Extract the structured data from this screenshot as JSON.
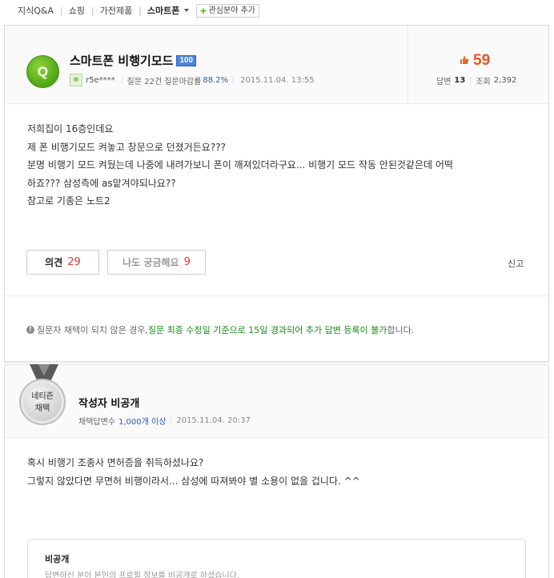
{
  "breadcrumb": {
    "items": [
      "지식Q&A",
      "쇼핑",
      "가전제품"
    ],
    "current": "스마트폰",
    "add_interest": "관심분야 추가"
  },
  "question": {
    "badge": "Q",
    "title": "스마트폰 비행기모드",
    "points": "100",
    "author": "r5e****",
    "stats_prefix": "질문 22건 질문마감률",
    "close_rate": "88.2%",
    "date": "2015.11.04. 13:55",
    "recommend_count": "59",
    "answers_label": "답변",
    "answers_count": "13",
    "views_label": "조회",
    "views_count": "2,392",
    "body": [
      "저희집이 16층인데요",
      "제 폰 비행기모드 켜놓고 창문으로 던졌거든요???",
      "분명 비행기 모드 켜뒀는데 나중에 내려가보니 폰이 깨져있더라구요... 비행기 모드 작동 안된것같은데 어떡",
      "하죠??? 삼성측에 as맡겨야되나요??",
      "참고로 기종은 노트2"
    ],
    "opinion_label": "의견",
    "opinion_count": "29",
    "curious_label": "나도 궁금해요",
    "curious_count": "9",
    "report_label": "신고",
    "notice_pre": "질문자 채택이 되지 않은 경우, ",
    "notice_green": "질문 최종 수정일 기준으로 15일 경과되어 추가 답변 등록이 불가",
    "notice_post": "합니다."
  },
  "answer": {
    "medal_line1": "네티즌",
    "medal_line2": "채택",
    "author": "작성자 비공개",
    "meta_prefix": "채택답변수",
    "meta_count": "1,000개 이상",
    "date": "2015.11.04. 20:37",
    "body": [
      "혹시 비행기 조종사 면허증을 취득하셨나요?",
      "그렇지 않았다면 무면허 비행이라서... 삼성에 따져봐야 별 소용이 없을 겁니다. ^^"
    ],
    "private_title": "비공개",
    "private_desc": "답변하신 분이 본인의 프로필 정보를 비공개로 하셨습니다."
  },
  "colors": {
    "recommend": "#e6562a",
    "notice_green": "#1a8a1a",
    "link_blue": "#2a5db0",
    "q_badge": "#5cb21c"
  }
}
